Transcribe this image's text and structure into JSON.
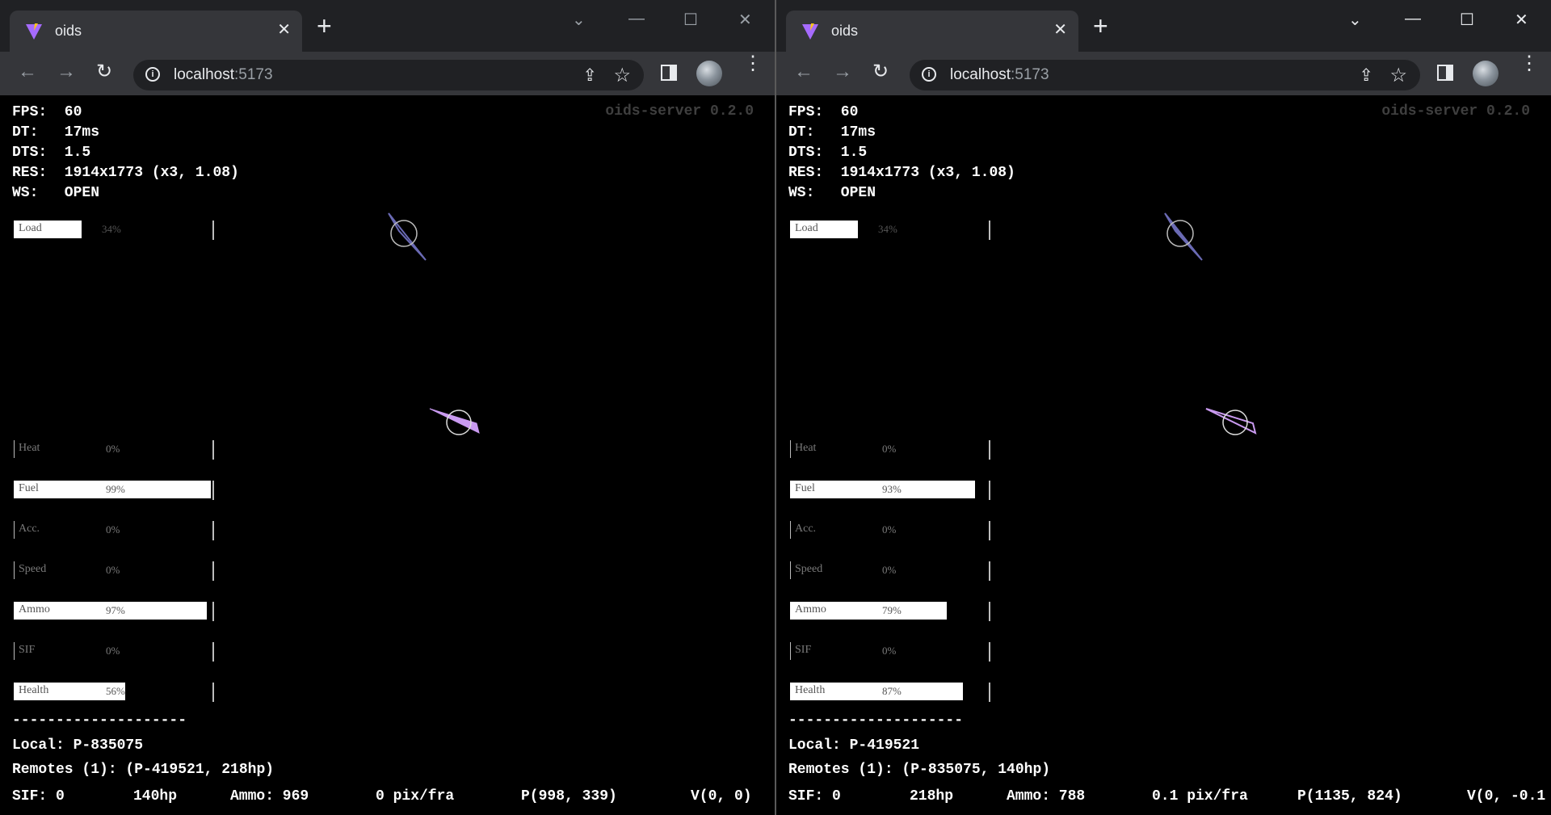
{
  "common": {
    "tab_title": "oids",
    "url_host": "localhost",
    "url_port": ":5173",
    "version": "oids-server 0.2.0",
    "new_tab_glyph": "+",
    "tab_close_glyph": "✕",
    "separator": "--------------------",
    "icons": [
      "vite-logo-icon",
      "close-icon",
      "plus-icon",
      "back-arrow-icon",
      "forward-arrow-icon",
      "reload-icon",
      "info-icon",
      "share-icon",
      "star-icon",
      "side-panel-icon",
      "avatar",
      "menu-dots-icon",
      "chevron-down-icon",
      "minimize-icon",
      "maximize-icon",
      "window-close-icon"
    ],
    "colors": {
      "ship_fill": "#c99af0",
      "ship_dim": "#6a6ab4",
      "bar_fill": "#ffffff",
      "background": "#000000"
    }
  },
  "left": {
    "stats": {
      "fps": "FPS:  60",
      "dt": "DT:   17ms",
      "dts": "DTS:  1.5",
      "res": "RES:  1914x1773 (x3, 1.08)",
      "ws": "WS:   OPEN"
    },
    "bars": [
      {
        "label": "Load",
        "pct": "34%",
        "value": 0.34
      },
      {
        "label": "Heat",
        "pct": "0%",
        "value": 0
      },
      {
        "label": "Fuel",
        "pct": "99%",
        "value": 0.99
      },
      {
        "label": "Acc.",
        "pct": "0%",
        "value": 0
      },
      {
        "label": "Speed",
        "pct": "0%",
        "value": 0
      },
      {
        "label": "Ammo",
        "pct": "97%",
        "value": 0.97
      },
      {
        "label": "SIF",
        "pct": "0%",
        "value": 0
      },
      {
        "label": "Health",
        "pct": "56%",
        "value": 0.56
      }
    ],
    "local": "Local: P-835075",
    "remotes": "Remotes (1): (P-419521, 218hp)",
    "bottom": {
      "sif": "SIF: 0",
      "hp": "140hp",
      "ammo": "Ammo: 969",
      "speed": "0 pix/fra",
      "pos": "P(998, 339)",
      "vel": "V(0, 0)"
    }
  },
  "right": {
    "stats": {
      "fps": "FPS:  60",
      "dt": "DT:   17ms",
      "dts": "DTS:  1.5",
      "res": "RES:  1914x1773 (x3, 1.08)",
      "ws": "WS:   OPEN"
    },
    "bars": [
      {
        "label": "Load",
        "pct": "34%",
        "value": 0.34
      },
      {
        "label": "Heat",
        "pct": "0%",
        "value": 0
      },
      {
        "label": "Fuel",
        "pct": "93%",
        "value": 0.93
      },
      {
        "label": "Acc.",
        "pct": "0%",
        "value": 0
      },
      {
        "label": "Speed",
        "pct": "0%",
        "value": 0
      },
      {
        "label": "Ammo",
        "pct": "79%",
        "value": 0.79
      },
      {
        "label": "SIF",
        "pct": "0%",
        "value": 0
      },
      {
        "label": "Health",
        "pct": "87%",
        "value": 0.87
      }
    ],
    "local": "Local: P-419521",
    "remotes": "Remotes (1): (P-835075, 140hp)",
    "bottom": {
      "sif": "SIF: 0",
      "hp": "218hp",
      "ammo": "Ammo: 788",
      "speed": "0.1 pix/fra",
      "pos": "P(1135, 824)",
      "vel": "V(0, -0.1"
    }
  }
}
